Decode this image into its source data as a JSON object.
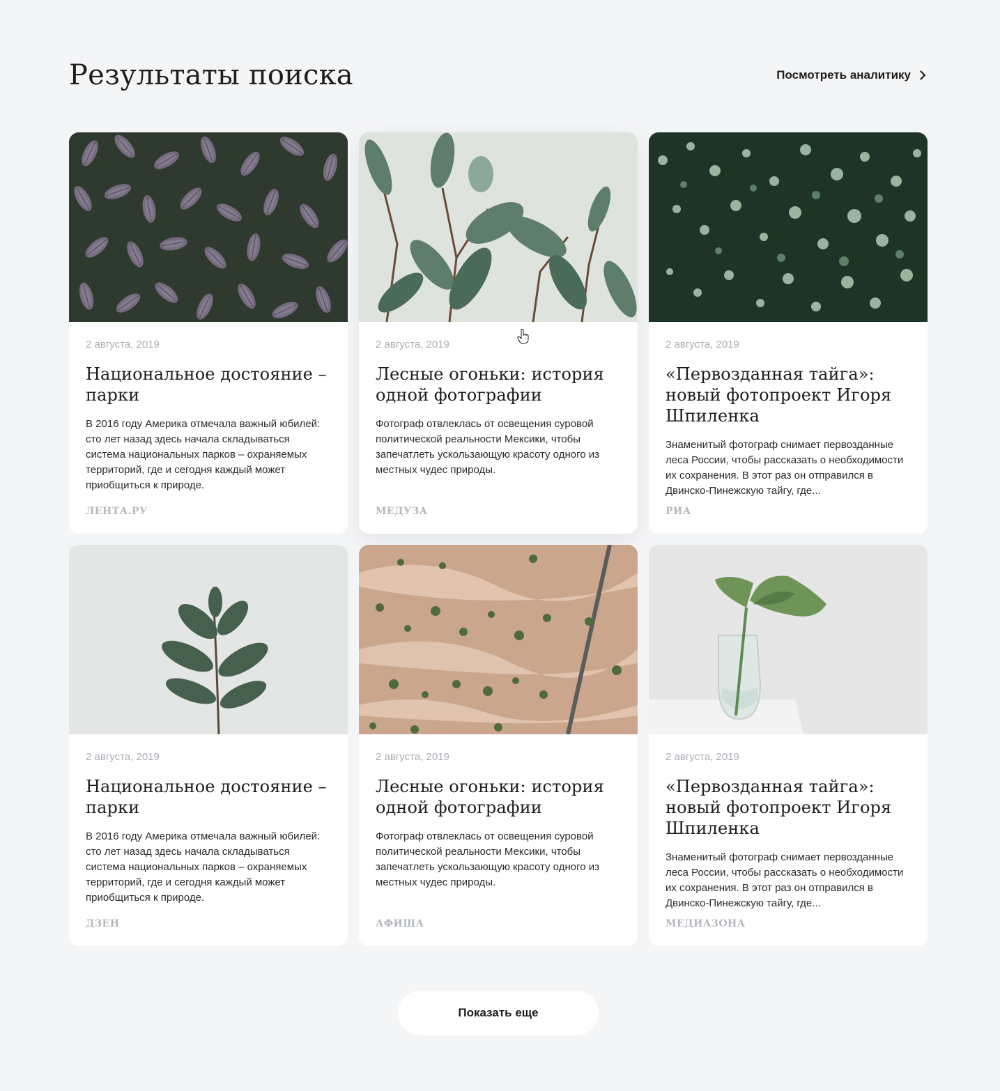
{
  "header": {
    "title": "Результаты поиска",
    "analytics_link": "Посмотреть аналитику",
    "analytics_icon": "chevron-right-icon"
  },
  "cards": [
    {
      "image": "purple-sage-leaves-photo",
      "date": "2 августа, 2019",
      "title": "Национальное достояние – парки",
      "excerpt": "В 2016 году Америка отмечала важный юбилей: сто лет назад здесь начала складываться система национальных парков – охраняемых территорий, где и сегодня каждый может приобщиться к природе.",
      "source": "ЛЕНТА.РУ"
    },
    {
      "image": "ficus-plant-photo",
      "date": "2 августа, 2019",
      "title": "Лесные огоньки: история одной фотографии",
      "excerpt": "Фотограф отвлеклась от освещения суровой политической реальности Мексики, чтобы запечатлеть ускользающую красоту одного из местных чудес природы.",
      "source": "МЕДУЗА"
    },
    {
      "image": "round-leaf-vine-photo",
      "date": "2 августа, 2019",
      "title": "«Первозданная тайга»: новый фотопроект Игоря Шпиленка",
      "excerpt": "Знаменитый фотограф снимает первозданные леса России, чтобы рассказать о необходимости их сохранения. В этот раз он отправился в Двинско-Пинежскую тайгу, где...",
      "source": "РИА"
    },
    {
      "image": "rubber-plant-stem-photo",
      "date": "2 августа, 2019",
      "title": "Национальное достояние – парки",
      "excerpt": "В 2016 году Америка отмечала важный юбилей: сто лет назад здесь начала складываться система национальных парков – охраняемых территорий, где и сегодня каждый может приобщиться к природе.",
      "source": "ДЗЕН"
    },
    {
      "image": "aerial-desert-landscape-photo",
      "date": "2 августа, 2019",
      "title": "Лесные огоньки: история одной фотографии",
      "excerpt": "Фотограф отвлеклась от освещения суровой политической реальности Мексики, чтобы запечатлеть ускользающую красоту одного из местных чудес природы.",
      "source": "АФИША"
    },
    {
      "image": "monstera-leaf-vase-photo",
      "date": "2 августа, 2019",
      "title": "«Первозданная тайга»: новый фотопроект Игоря Шпиленка",
      "excerpt": "Знаменитый фотограф снимает первозданные леса России, чтобы рассказать о необходимости их сохранения. В этот раз он отправился в Двинско-Пинежскую тайгу, где...",
      "source": "МЕДИАЗОНА"
    }
  ],
  "load_more": {
    "label": "Показать еще"
  },
  "colors": {
    "background": "#f4f5f7",
    "card": "#ffffff",
    "text": "#1d1d1d",
    "muted": "#a9adb3"
  }
}
